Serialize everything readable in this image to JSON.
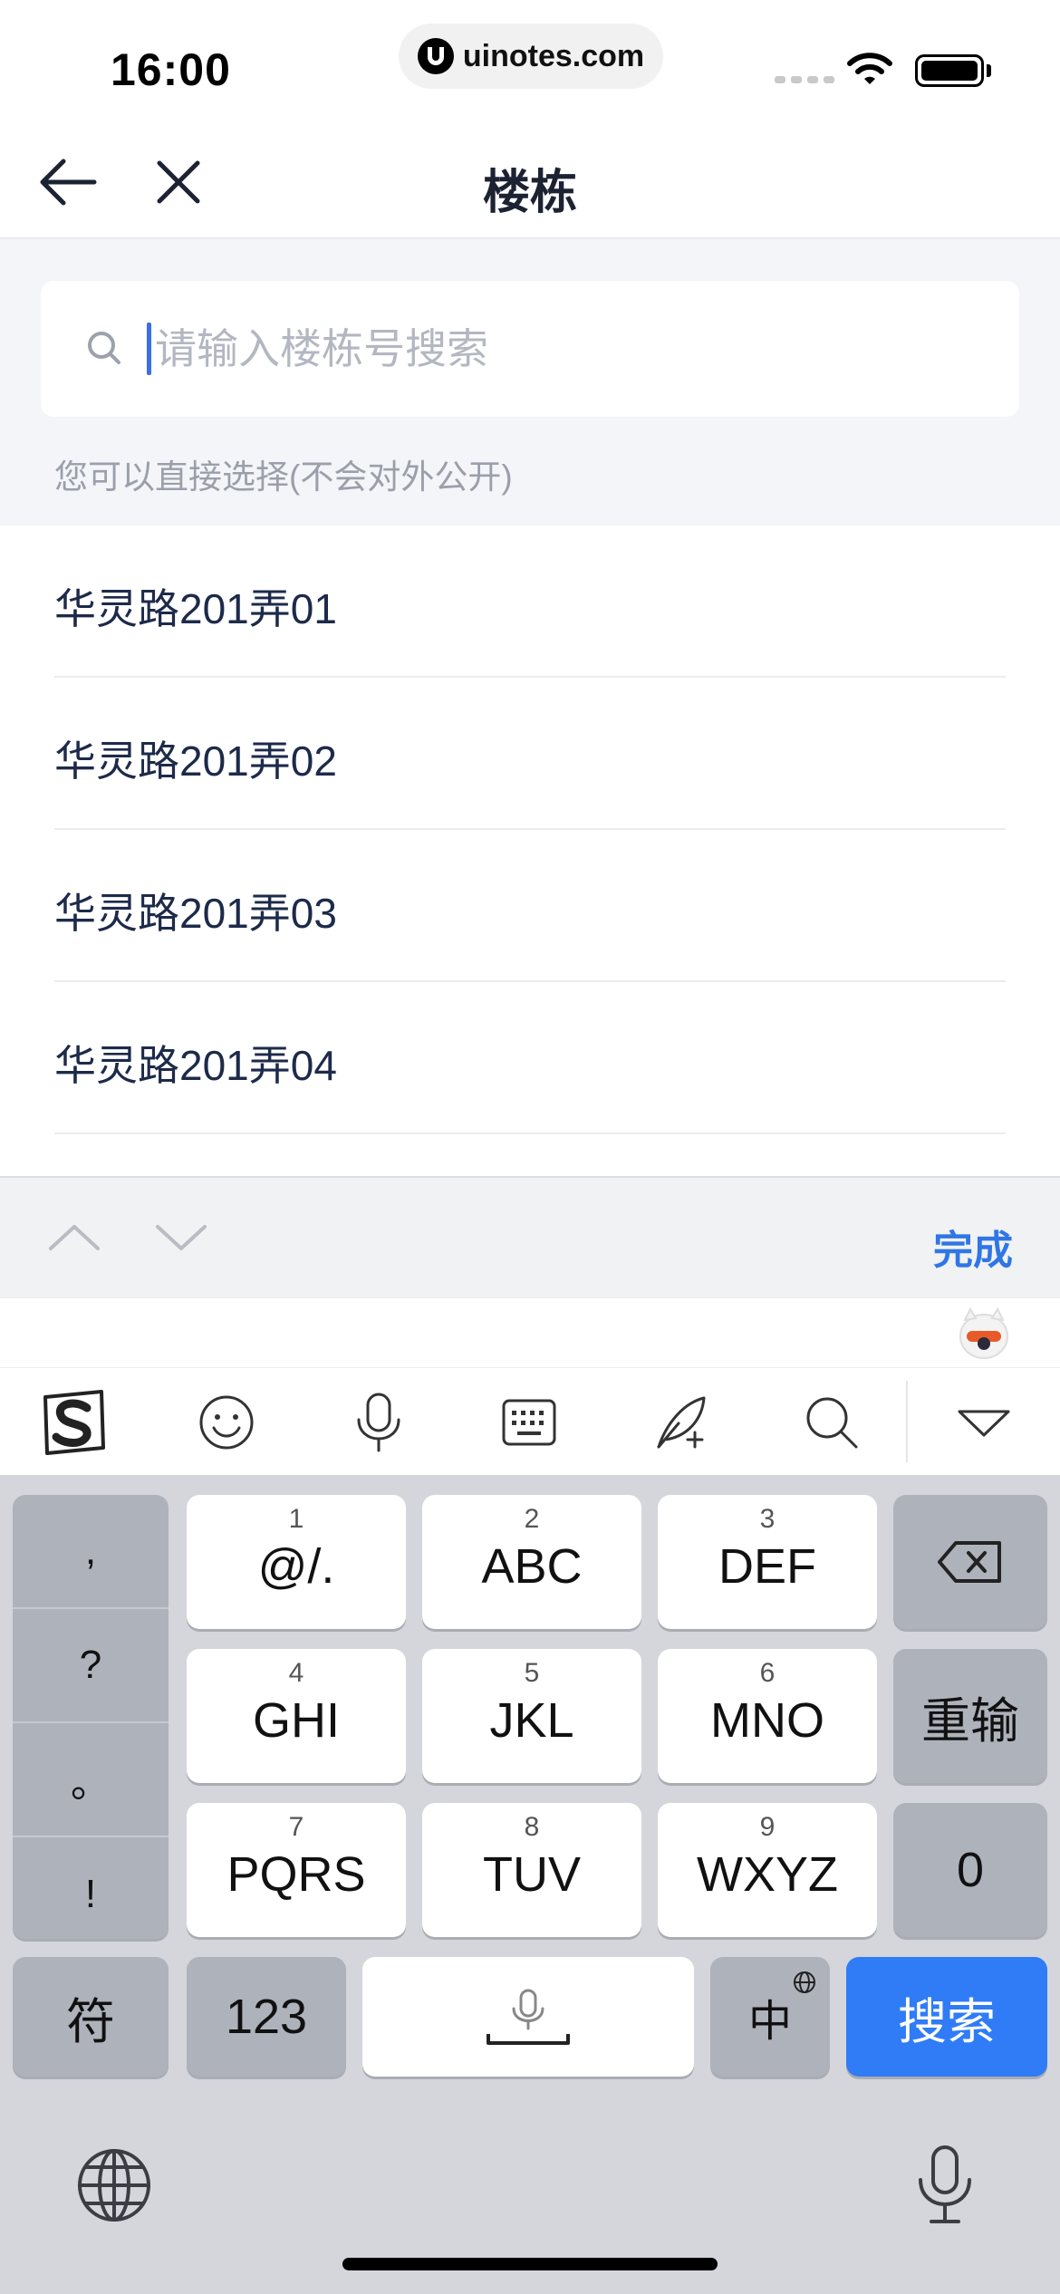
{
  "status_bar": {
    "time": "16:00",
    "url": "uinotes.com"
  },
  "nav": {
    "title": "楼栋"
  },
  "search": {
    "placeholder": "请输入楼栋号搜索",
    "hint": "您可以直接选择(不会对外公开)"
  },
  "list": {
    "items": [
      {
        "label": "华灵路201弄01"
      },
      {
        "label": "华灵路201弄02"
      },
      {
        "label": "华灵路201弄03"
      },
      {
        "label": "华灵路201弄04"
      }
    ]
  },
  "keyboard_toolbar": {
    "done_label": "完成"
  },
  "keyboard": {
    "punct": [
      ",",
      "?",
      "。",
      "!"
    ],
    "keys": [
      {
        "num": "1",
        "letters": "@/."
      },
      {
        "num": "2",
        "letters": "ABC"
      },
      {
        "num": "3",
        "letters": "DEF"
      },
      {
        "num": "4",
        "letters": "GHI"
      },
      {
        "num": "5",
        "letters": "JKL"
      },
      {
        "num": "6",
        "letters": "MNO"
      },
      {
        "num": "7",
        "letters": "PQRS"
      },
      {
        "num": "8",
        "letters": "TUV"
      },
      {
        "num": "9",
        "letters": "WXYZ"
      }
    ],
    "reset_label": "重输",
    "zero_label": "0",
    "symbols_label": "符",
    "numbers_label": "123",
    "lang_label": "中",
    "search_label": "搜索"
  }
}
